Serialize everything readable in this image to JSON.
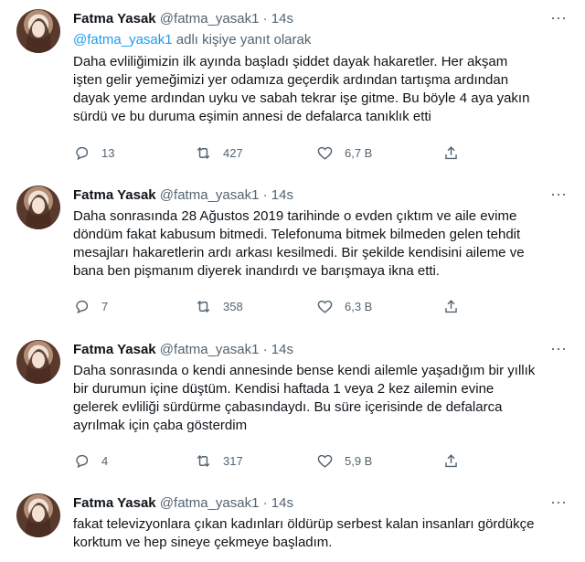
{
  "tweets": [
    {
      "name": "Fatma Yasak",
      "handle": "@fatma_yasak1",
      "dot": "·",
      "time": "14s",
      "reply_mention": "@fatma_yasak1",
      "reply_suffix": " adlı kişiye yanıt olarak",
      "lines": [
        "Daha evliliğimizin ilk ayında başladı şiddet dayak hakaretler. Her akşam",
        "işten gelir yemeğimizi yer odamıza geçerdik ardından tartışma ardından",
        "dayak yeme ardından uyku ve sabah tekrar işe gitme. Bu böyle 4 aya yakın",
        "sürdü ve bu duruma eşimin annesi de defalarca tanıklık etti"
      ],
      "replies": "13",
      "retweets": "427",
      "likes": "6,7 B"
    },
    {
      "name": "Fatma Yasak",
      "handle": "@fatma_yasak1",
      "dot": "·",
      "time": "14s",
      "lines": [
        "Daha sonrasında 28 Ağustos 2019 tarihinde o evden çıktım ve aile evime",
        "döndüm fakat kabusum bitmedi. Telefonuma bitmek bilmeden gelen tehdit",
        "mesajları hakaretlerin ardı arkası kesilmedi. Bir şekilde kendisini aileme ve",
        "bana ben pişmanım diyerek inandırdı ve barışmaya ikna etti."
      ],
      "replies": "7",
      "retweets": "358",
      "likes": "6,3 B"
    },
    {
      "name": "Fatma Yasak",
      "handle": "@fatma_yasak1",
      "dot": "·",
      "time": "14s",
      "lines": [
        "Daha sonrasında o kendi annesinde bense kendi ailemle yaşadığım bir yıllık",
        "bir durumun içine düştüm. Kendisi haftada 1 veya 2 kez ailemin evine",
        "gelerek evliliği sürdürme çabasındaydı. Bu süre içerisinde de defalarca",
        "ayrılmak için çaba gösterdim"
      ],
      "replies": "4",
      "retweets": "317",
      "likes": "5,9 B"
    },
    {
      "name": "Fatma Yasak",
      "handle": "@fatma_yasak1",
      "dot": "·",
      "time": "14s",
      "lines": [
        "fakat televizyonlara çıkan kadınları öldürüp serbest kalan insanları gördükçe",
        "korktum ve hep sineye çekmeye başladım."
      ]
    }
  ]
}
